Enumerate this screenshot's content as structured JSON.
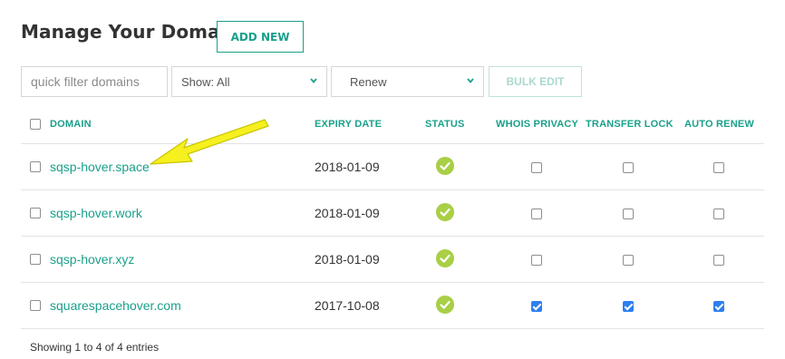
{
  "header": {
    "title": "Manage Your Domains",
    "add_label": "ADD NEW"
  },
  "toolbar": {
    "filter_placeholder": "quick filter domains",
    "filter_value": "",
    "show_value": "Show: All",
    "renew_value": "Renew",
    "bulk_edit_label": "BULK EDIT"
  },
  "table": {
    "columns": {
      "domain": "DOMAIN",
      "expiry": "EXPIRY DATE",
      "status": "STATUS",
      "whois": "WHOIS PRIVACY",
      "transfer": "TRANSFER LOCK",
      "renew": "AUTO RENEW"
    },
    "rows": [
      {
        "domain": "sqsp-hover.space",
        "expiry": "2018-01-09",
        "status": "active",
        "whois": false,
        "transfer": false,
        "renew": false
      },
      {
        "domain": "sqsp-hover.work",
        "expiry": "2018-01-09",
        "status": "active",
        "whois": false,
        "transfer": false,
        "renew": false
      },
      {
        "domain": "sqsp-hover.xyz",
        "expiry": "2018-01-09",
        "status": "active",
        "whois": false,
        "transfer": false,
        "renew": false
      },
      {
        "domain": "squarespacehover.com",
        "expiry": "2017-10-08",
        "status": "active",
        "whois": true,
        "transfer": true,
        "renew": true
      }
    ]
  },
  "footer": {
    "entries_text": "Showing 1 to 4 of 4 entries"
  },
  "colors": {
    "accent": "#1aa08a",
    "status_ok": "#a8cf45",
    "checked": "#2d7ff0",
    "annotation_arrow": "#f5f01e"
  },
  "icons": {
    "status": "check-circle-icon",
    "select": "chevron-down-icon",
    "annotation": "arrow-annotation"
  }
}
